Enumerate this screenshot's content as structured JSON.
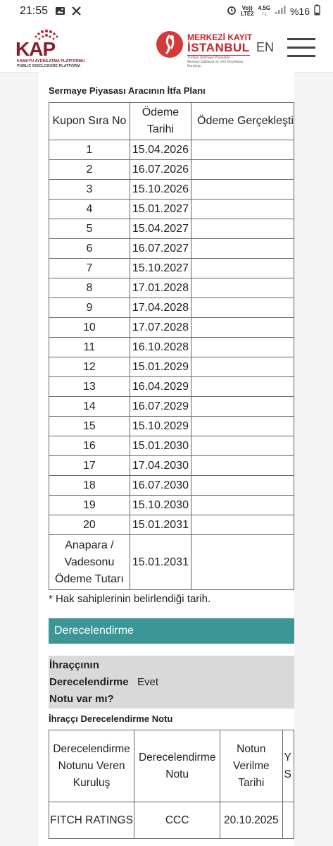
{
  "status_bar": {
    "time": "21:55",
    "left_icons": [
      "image-icon",
      "x-logo-icon"
    ],
    "network_top": "Vo))",
    "network_bottom": "LTE2",
    "signal_top": "4.5G",
    "battery": "%16"
  },
  "header": {
    "kap_brand": "KAP",
    "kap_line1": "KAMUYU AYDINLATMA PLATFORMU",
    "kap_line2": "PUBLIC DISCLOSURE PLATFORM",
    "mki_line1": "MERKEZİ KAYIT",
    "mki_line2": "İSTANBUL",
    "mki_sub": "Türkiye Sermaye Piyasaları – Merkezi Saklama ve Veri Depolama Kuruluşu",
    "language": "EN"
  },
  "plan": {
    "title": "Sermaye Piyasası Aracının İtfa Planı",
    "columns": [
      "Kupon Sıra No",
      "Ödeme Tarihi",
      "Ödeme Gerçekleşti"
    ],
    "rows": [
      {
        "no": "1",
        "date": "15.04.2026"
      },
      {
        "no": "2",
        "date": "16.07.2026"
      },
      {
        "no": "3",
        "date": "15.10.2026"
      },
      {
        "no": "4",
        "date": "15.01.2027"
      },
      {
        "no": "5",
        "date": "15.04.2027"
      },
      {
        "no": "6",
        "date": "16.07.2027"
      },
      {
        "no": "7",
        "date": "15.10.2027"
      },
      {
        "no": "8",
        "date": "17.01.2028"
      },
      {
        "no": "9",
        "date": "17.04.2028"
      },
      {
        "no": "10",
        "date": "17.07.2028"
      },
      {
        "no": "11",
        "date": "16.10.2028"
      },
      {
        "no": "12",
        "date": "15.01.2029"
      },
      {
        "no": "13",
        "date": "16.04.2029"
      },
      {
        "no": "14",
        "date": "16.07.2029"
      },
      {
        "no": "15",
        "date": "15.10.2029"
      },
      {
        "no": "16",
        "date": "15.01.2030"
      },
      {
        "no": "17",
        "date": "17.04.2030"
      },
      {
        "no": "18",
        "date": "16.07.2030"
      },
      {
        "no": "19",
        "date": "15.10.2030"
      },
      {
        "no": "20",
        "date": "15.01.2031"
      }
    ],
    "final_row": {
      "label": "Anapara / Vadesonu Ödeme Tutarı",
      "date": "15.01.2031"
    },
    "note": "* Hak sahiplerinin belirlendiği tarih."
  },
  "rating": {
    "section": "Derecelendirme",
    "question": "İhraççının Derecelendirme Notu var mı?",
    "answer": "Evet",
    "issuer_title": "İhraççı Derecelendirme Notu",
    "columns": [
      "Derecelendirme Notunu Veren Kuruluş",
      "Derecelendirme Notu",
      "Notun Verilme Tarihi",
      "Y S"
    ],
    "row": {
      "agency": "FITCH RATINGS",
      "grade": "CCC",
      "date": "20.10.2025"
    }
  }
}
